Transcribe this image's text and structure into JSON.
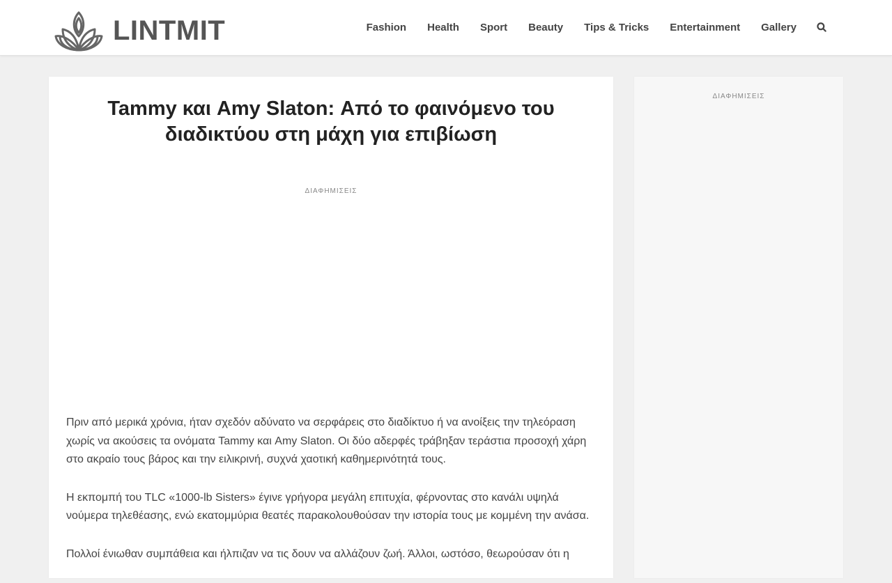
{
  "header": {
    "logo_text": "LINTMIT",
    "logo_icon": "lotus-icon",
    "nav": [
      {
        "label": "Fashion"
      },
      {
        "label": "Health"
      },
      {
        "label": "Sport"
      },
      {
        "label": "Beauty"
      },
      {
        "label": "Tips & Tricks"
      },
      {
        "label": "Entertainment"
      },
      {
        "label": "Gallery"
      }
    ],
    "search_icon": "search-icon"
  },
  "article": {
    "title_line1": "Tammy και Amy Slaton: Από το φαινόμενο του",
    "title_line2": "διαδικτύου στη μάχη για επιβίωση",
    "ad_label": "ΔΙΑΦΗΜΙΣΕΙΣ",
    "paragraphs": [
      "Πριν από μερικά χρόνια, ήταν σχεδόν αδύνατο να σερφάρεις στο διαδίκτυο ή να ανοίξεις την τηλεόραση χωρίς να ακούσεις τα ονόματα Tammy και Amy Slaton. Οι δύο αδερφές τράβηξαν τεράστια προσοχή χάρη στο ακραίο τους βάρος και την ειλικρινή, συχνά χαοτική καθημερινότητά τους.",
      "Η εκπομπή του TLC «1000-lb Sisters» έγινε γρήγορα μεγάλη επιτυχία, φέρνοντας στο κανάλι υψηλά νούμερα τηλεθέασης, ενώ εκατομμύρια θεατές παρακολουθούσαν την ιστορία τους με κομμένη την ανάσα.",
      "Πολλοί ένιωθαν συμπάθεια και ήλπιζαν να τις δουν να αλλάζουν ζωή. Άλλοι, ωστόσο, θεωρούσαν ότι η"
    ]
  },
  "sidebar": {
    "ad_label": "ΔΙΑΦΗΜΙΣΕΙΣ"
  },
  "colors": {
    "page_background": "#f0f0f0",
    "header_background": "#ffffff",
    "logo_gray": "#555555",
    "nav_text": "#444444",
    "title_text": "#222222",
    "body_text": "#444444",
    "ad_label": "#888888",
    "sidebar_background": "#f7f7f7"
  }
}
